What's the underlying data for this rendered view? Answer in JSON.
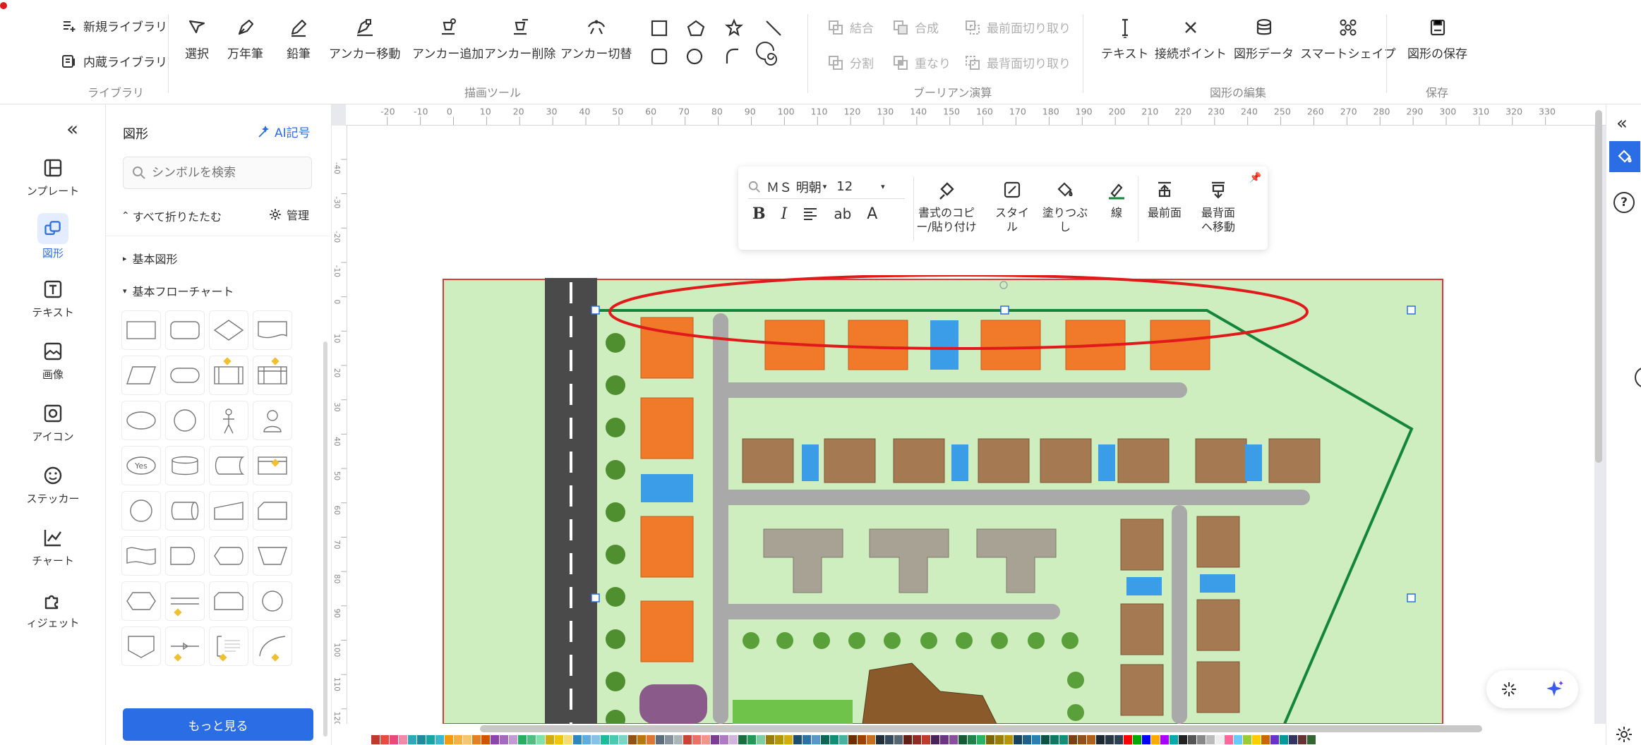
{
  "ribbon": {
    "library": {
      "new_library": "新規ライブラリ",
      "builtin_library": "内蔵ライブラリ",
      "group_label": "ライブラリ"
    },
    "drawing_tools": {
      "select": "選択",
      "fountain_pen": "万年筆",
      "pencil": "鉛筆",
      "anchor_move": "アンカー移動",
      "anchor_add": "アンカー追加",
      "anchor_delete": "アンカー削除",
      "anchor_toggle": "アンカー切替",
      "group_label": "描画ツール"
    },
    "boolean_ops": {
      "union": "結合",
      "combine": "合成",
      "front_trim": "最前面切り取り",
      "split": "分割",
      "intersect": "重なり",
      "back_trim": "最背面切り取り",
      "group_label": "ブーリアン演算"
    },
    "shape_edit": {
      "text": "テキスト",
      "connection_point": "接続ポイント",
      "shape_data": "図形データ",
      "smart_shape": "スマートシェイプ",
      "group_label": "図形の編集"
    },
    "save": {
      "save_shape": "図形の保存",
      "group_label": "保存"
    }
  },
  "leftnav": {
    "collapse_icon": "chevrons-left-icon",
    "items": [
      {
        "label": "ンプレート",
        "icon": "template-icon"
      },
      {
        "label": "図形",
        "icon": "shapes-icon",
        "active": true
      },
      {
        "label": "テキスト",
        "icon": "text-icon"
      },
      {
        "label": "画像",
        "icon": "image-icon"
      },
      {
        "label": "アイコン",
        "icon": "icon-icon"
      },
      {
        "label": "ステッカー",
        "icon": "sticker-icon"
      },
      {
        "label": "チャート",
        "icon": "chart-icon"
      },
      {
        "label": "ィジェット",
        "icon": "widget-icon"
      }
    ]
  },
  "panel": {
    "title": "図形",
    "ai_symbol": "AI記号",
    "search_placeholder": "シンボルを検索",
    "collapse_all": "すべて折りたたむ",
    "manage": "管理",
    "section_basic": "基本図形",
    "section_flowchart": "基本フローチャート",
    "more_button": "もっと見る",
    "yes_label": "Yes"
  },
  "ruler": {
    "h_ticks": [
      "-20",
      "-10",
      "0",
      "10",
      "20",
      "30",
      "40",
      "50",
      "60",
      "70",
      "80",
      "90",
      "100",
      "110",
      "120",
      "130",
      "140",
      "150",
      "160",
      "170",
      "180",
      "190",
      "200",
      "210",
      "220",
      "230",
      "240",
      "250",
      "260",
      "270",
      "280",
      "290",
      "300",
      "310",
      "320",
      "330"
    ],
    "v_ticks": [
      "-40",
      "-30",
      "-20",
      "-10",
      "0",
      "10",
      "20",
      "30",
      "40",
      "50",
      "60",
      "70",
      "80",
      "90",
      "100",
      "110",
      "120"
    ]
  },
  "floating_toolbar": {
    "font_name": "ＭＳ 明朝",
    "font_size": "12",
    "format_copy": "書式のコピー/貼り付け",
    "style": "スタイル",
    "fill": "塗りつぶし",
    "line": "線",
    "bring_front": "最前面",
    "send_back": "最背面へ移動"
  },
  "colors": {
    "accent": "#2b6de5",
    "annotation_red": "#e0191b",
    "path_green": "#14853a",
    "plan_bg": "#cfeec0"
  }
}
